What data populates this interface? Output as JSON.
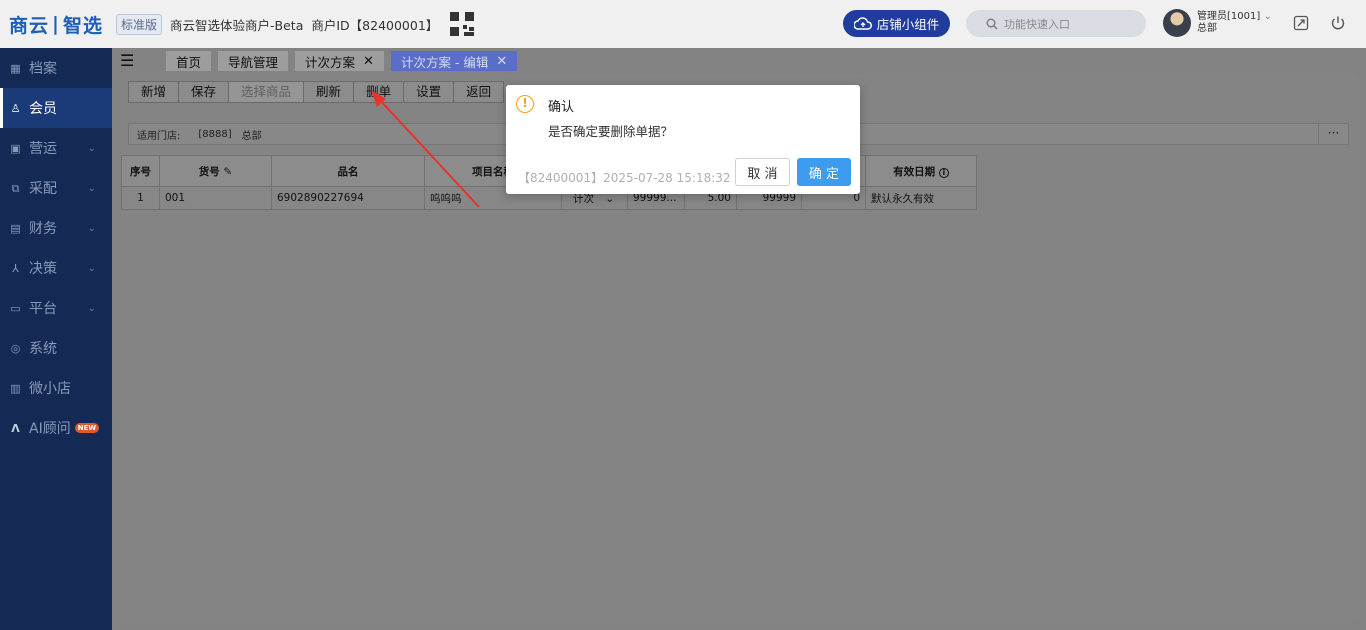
{
  "header": {
    "logo_part1": "商云",
    "logo_part2": "智选",
    "edition": "标准版",
    "merchant": "商云智选体验商户-Beta",
    "merchant_id": "商户ID【82400001】",
    "widget_button": "店铺小组件",
    "search_placeholder": "功能快速入口",
    "user_name": "管理员[1001]",
    "user_org": "总部"
  },
  "sidebar": {
    "items": [
      {
        "label": "档案",
        "icon": "archive-icon",
        "has_chevron": false
      },
      {
        "label": "会员",
        "icon": "member-icon",
        "has_chevron": false,
        "active": true
      },
      {
        "label": "营运",
        "icon": "operations-icon",
        "has_chevron": true
      },
      {
        "label": "采配",
        "icon": "purchase-icon",
        "has_chevron": true
      },
      {
        "label": "财务",
        "icon": "finance-icon",
        "has_chevron": true
      },
      {
        "label": "决策",
        "icon": "decision-icon",
        "has_chevron": true
      },
      {
        "label": "平台",
        "icon": "platform-icon",
        "has_chevron": true
      },
      {
        "label": "系统",
        "icon": "system-icon",
        "has_chevron": false
      },
      {
        "label": "微小店",
        "icon": "mini-store-icon",
        "has_chevron": false
      },
      {
        "label": "AI顾问",
        "icon": "ai-icon",
        "has_chevron": false,
        "badge": "NEW"
      }
    ]
  },
  "tabs": [
    {
      "label": "首页",
      "closable": false
    },
    {
      "label": "导航管理",
      "closable": false
    },
    {
      "label": "计次方案",
      "closable": true
    },
    {
      "label": "计次方案 - 编辑",
      "closable": true,
      "active": true
    }
  ],
  "toolbar": {
    "new": "新增",
    "save": "保存",
    "select_goods": "选择商品",
    "refresh": "刷新",
    "delete": "删单",
    "settings": "设置",
    "back": "返回"
  },
  "store_filter": {
    "label": "适用门店:",
    "code": "[8888]",
    "name": "总部",
    "more": "···"
  },
  "table": {
    "headers": [
      "序号",
      "货号",
      "品名",
      "项目名称",
      "",
      "",
      "",
      "",
      "",
      "有效日期"
    ],
    "rows": [
      [
        "1",
        "001",
        "6902890227694",
        "呜呜呜",
        "计次",
        "99999...",
        "5.00",
        "99999",
        "0",
        "默认永久有效"
      ]
    ]
  },
  "dialog": {
    "title": "确认",
    "message": "是否确定要删除单据？",
    "stamp": "【82400001】2025-07-28 15:18:32",
    "cancel": "取 消",
    "ok": "确 定"
  },
  "colors": {
    "sidebar_bg": "#142a55",
    "active_tab": "#5a6dc9",
    "primary_button": "#3d9cf0",
    "warning_icon": "#f0a21f",
    "arrow": "#e8322b"
  }
}
